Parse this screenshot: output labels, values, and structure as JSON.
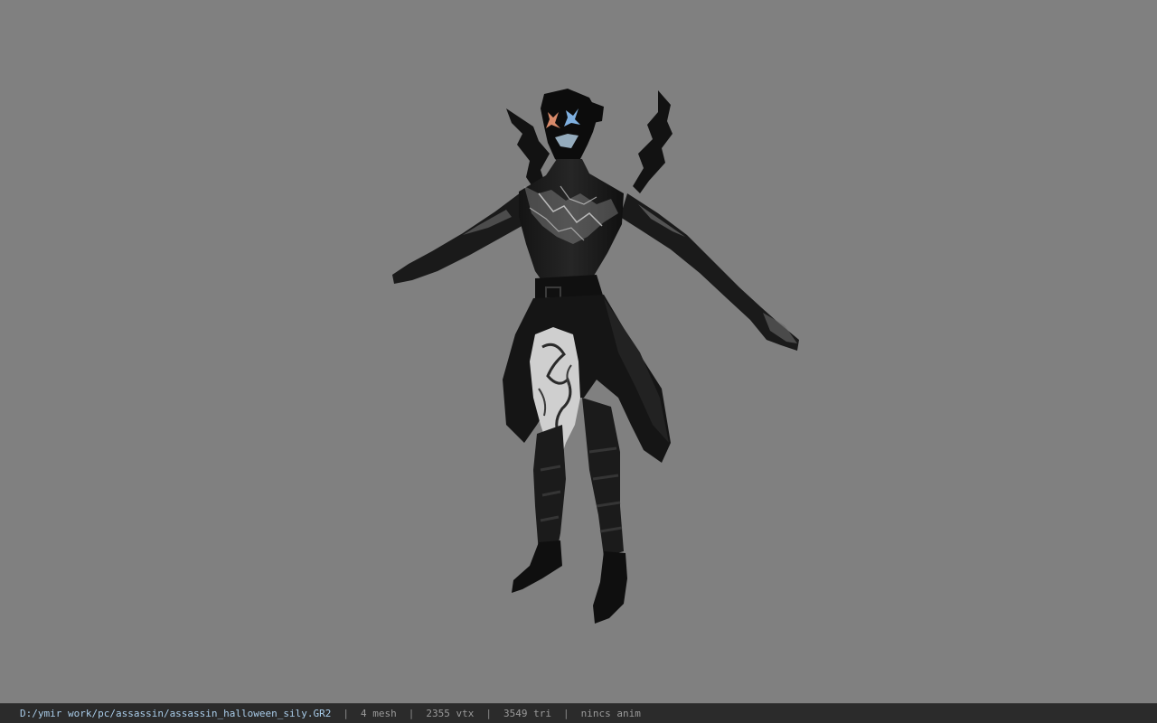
{
  "viewport": {
    "background_color": "#808080",
    "model_icon": "assassin-character-model"
  },
  "statusbar": {
    "file_path": "D:/ymir work/pc/assassin/assassin_halloween_sily.GR2",
    "separator": "|",
    "mesh_count": "4 mesh",
    "vertex_count": "2355 vtx",
    "triangle_count": "3549 tri",
    "anim_status": "nincs anim",
    "path_color": "#a8cbe8",
    "stat_color": "#9a9a9a"
  }
}
